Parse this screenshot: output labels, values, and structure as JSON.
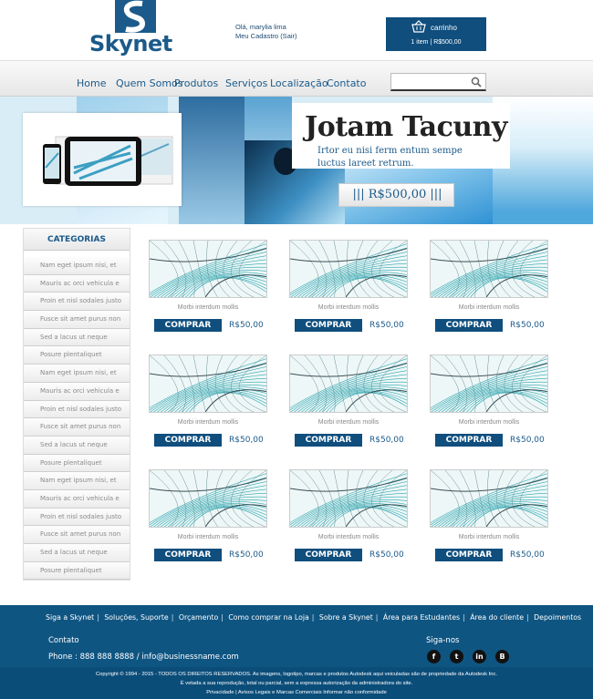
{
  "header": {
    "logo_text": "Skynet",
    "greeting": "Olá, marylia lima",
    "account_link": "Meu Cadastro (Sair)",
    "cart_label": "carrinho",
    "cart_summary": "1 item | R$500,00"
  },
  "nav": {
    "items": [
      "Home",
      "Quem Somos",
      "Produtos",
      "Serviços",
      "Localização",
      "Contato"
    ],
    "search_value": ""
  },
  "banner": {
    "title": "Jotam Tacuny",
    "subtitle": "Irtor eu nisi ferm entum sempe luctus lareet retrum.",
    "price": "||| R$500,00 |||"
  },
  "sidebar": {
    "title": "CATEGORIAS",
    "items": [
      "Nam eget ipsum nisi, et",
      "Mauris ac orci vehicula e",
      "Proin et nisl sodales justo",
      "Fusce sit amet purus non",
      "Sed a lacus ut neque",
      "Posure plentaliquet",
      "Nam eget ipsum nisi, et",
      "Mauris ac orci vehicula e",
      "Proin et nisl sodales justo",
      "Fusce sit amet purus non",
      "Sed a lacus ut neque",
      "Posure plentaliquet",
      "Nam eget ipsum nisi, et",
      "Mauris ac orci vehicula e",
      "Proin et nisl sodales justo",
      "Fusce sit amet purus non",
      "Sed a lacus ut neque",
      "Posure plentaliquet"
    ]
  },
  "products": [
    {
      "name": "Morbi interdum mollis",
      "button": "COMPRAR",
      "price": "R$50,00"
    },
    {
      "name": "Morbi interdum mollis",
      "button": "COMPRAR",
      "price": "R$50,00"
    },
    {
      "name": "Morbi interdum mollis",
      "button": "COMPRAR",
      "price": "R$50,00"
    },
    {
      "name": "Morbi interdum mollis",
      "button": "COMPRAR",
      "price": "R$50,00"
    },
    {
      "name": "Morbi interdum mollis",
      "button": "COMPRAR",
      "price": "R$50,00"
    },
    {
      "name": "Morbi interdum mollis",
      "button": "COMPRAR",
      "price": "R$50,00"
    },
    {
      "name": "Morbi interdum mollis",
      "button": "COMPRAR",
      "price": "R$50,00"
    },
    {
      "name": "Morbi interdum mollis",
      "button": "COMPRAR",
      "price": "R$50,00"
    },
    {
      "name": "Morbi interdum mollis",
      "button": "COMPRAR",
      "price": "R$50,00"
    }
  ],
  "footer": {
    "links": [
      "Siga a Skynet",
      "Soluções, Suporte",
      "Orçamento",
      "Como comprar na Loja",
      "Sobre a Skynet",
      "Área para Estudantes",
      "Área do cliente",
      "Depoimentos"
    ],
    "contact_title": "Contato",
    "contact_line": "Phone : 888 888 8888  / info@businessname.com",
    "social_title": "Siga-nos",
    "social_icons": [
      "facebook-icon",
      "twitter-icon",
      "linkedin-icon",
      "blogger-icon"
    ],
    "legal_1": "Copyright © 1994 - 2015 - TODOS OS DIREITOS RESERVADOS. As imagens, logotipo, marcas e produtos Autodesk aqui veiculadas são de propriedade da Autodesk Inc.",
    "legal_2": "É vetada a sua reprodução, total ou parcial, sem a expressa autorização da administradora do site.",
    "legal_3": "Privacidade  | Avisos Legais e Marcas Comerciais  Informar não conformidade"
  },
  "colors": {
    "brand_blue": "#0f4e7d",
    "text_blue": "#1b5a8a",
    "footer_blue": "#0f5582"
  }
}
